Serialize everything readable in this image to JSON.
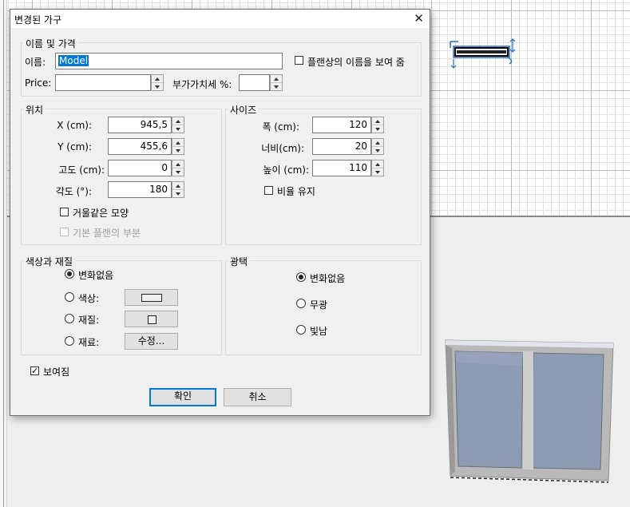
{
  "dialog": {
    "title": "변경된 가구",
    "close_glyph": "✕",
    "name_price": {
      "legend": "이름 및 가격",
      "name_label": "이름:",
      "name_value": "Model",
      "show_name_label": "플랜상의 이름을 보여 줌",
      "show_name_checked": false,
      "price_label": "Price:",
      "price_value": "",
      "vat_label": "부가가치세 %:",
      "vat_value": ""
    },
    "location": {
      "legend": "위치",
      "x_label": "X (cm):",
      "x_value": "945,5",
      "y_label": "Y (cm):",
      "y_value": "455,6",
      "elev_label": "고도 (cm):",
      "elev_value": "0",
      "angle_label": "각도 (°):",
      "angle_value": "180",
      "mirror_label": "거울같은 모양",
      "mirror_checked": false,
      "base_plan_label": "기본 플랜의 부분",
      "base_plan_enabled": false
    },
    "size": {
      "legend": "사이즈",
      "width_label": "폭 (cm):",
      "width_value": "120",
      "depth_label": "너비(cm):",
      "depth_value": "20",
      "height_label": "높이 (cm):",
      "height_value": "110",
      "keep_ratio_label": "비율 유지",
      "keep_ratio_checked": false
    },
    "color_material": {
      "legend": "색상과 재질",
      "unchanged_label": "변화없음",
      "color_label": "색상:",
      "texture_label": "재질:",
      "materials_label": "재료:",
      "modify_button": "수정...",
      "selected": "unchanged"
    },
    "shininess": {
      "legend": "광택",
      "unchanged_label": "변화없음",
      "matte_label": "무광",
      "shiny_label": "빛남",
      "selected": "unchanged"
    },
    "visible_label": "보여짐",
    "visible_checked": true,
    "ok_button": "확인",
    "cancel_button": "취소"
  },
  "colors": {
    "accent": "#0078d7",
    "plan_background": "#ffffff",
    "view3d_background": "#eeeeee",
    "window_frame": "#b9b9b9",
    "window_glass": "#8e9bb5"
  }
}
